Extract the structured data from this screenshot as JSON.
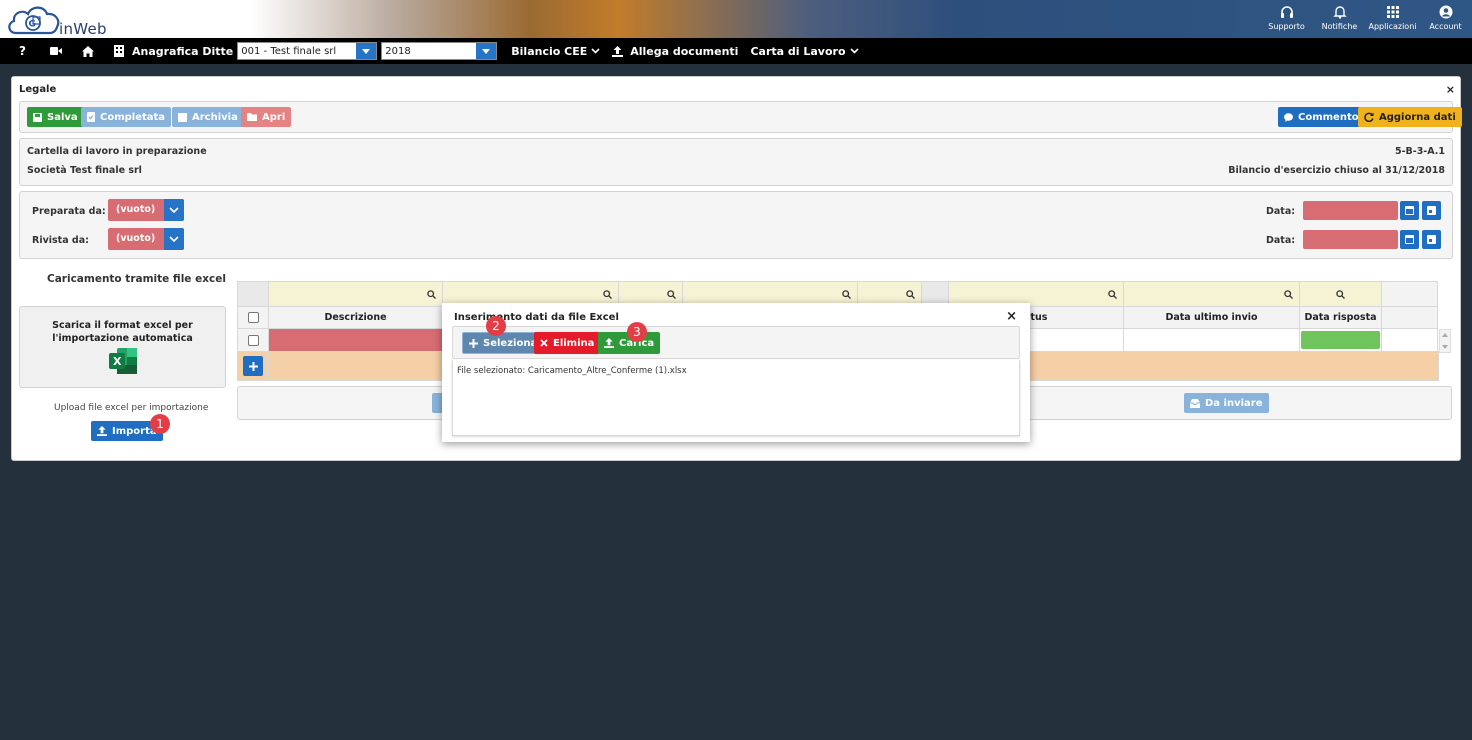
{
  "brand": {
    "logo_text": "inWeb"
  },
  "top_actions": [
    {
      "label": "Supporto",
      "icon": "headset-icon"
    },
    {
      "label": "Notifiche",
      "icon": "bell-icon"
    },
    {
      "label": "Applicazioni",
      "icon": "grid-icon"
    },
    {
      "label": "Account",
      "icon": "user-circle-icon"
    }
  ],
  "navbar": {
    "help": "?",
    "anagrafica_label": "Anagrafica Ditte",
    "company_select": "001 - Test finale srl",
    "year_select": "2018",
    "bilancio_label": "Bilancio CEE",
    "allega_label": "Allega documenti",
    "carta_label": "Carta di Lavoro"
  },
  "panel": {
    "title": "Legale",
    "close": "×",
    "toolbar": {
      "salva": "Salva",
      "completata": "Completata",
      "archivia": "Archivia",
      "apri": "Apri",
      "commento": "Commento",
      "aggiorna": "Aggiorna dati"
    },
    "info": {
      "status": "Cartella di lavoro in preparazione",
      "code": "5-B-3-A.1",
      "company": "Società Test finale srl",
      "period": "Bilancio d'esercizio chiuso al 31/12/2018"
    },
    "review": {
      "preparata_label": "Preparata da:",
      "preparata_value": "(vuoto)",
      "rivista_label": "Rivista da:",
      "rivista_value": "(vuoto)",
      "data_label_1": "Data:",
      "data_label_2": "Data:"
    },
    "excel": {
      "heading": "Caricamento tramite file excel",
      "download_text": "Scarica il format excel per l'importazione automatica",
      "upload_text": "Upload file excel per importazione",
      "importa": "Importa"
    },
    "grid": {
      "col_descrizione": "Descrizione",
      "col_status": "atus",
      "col_data_ultimo_invio": "Data ultimo invio",
      "col_data_risposta": "Data risposta",
      "btn_da_inviare": "Da inviare"
    }
  },
  "modal": {
    "title": "Inserimento dati da file Excel",
    "close": "×",
    "seleziona": "Seleziona",
    "elimina": "Elimina",
    "carica": "Carica",
    "file_text": "File selezionato: Caricamento_Altre_Conferme (1).xlsx"
  },
  "badges": [
    "1",
    "2",
    "3"
  ],
  "colors": {
    "primary_blue": "#1f6ec1",
    "success_green": "#2f9a3a",
    "danger_red": "#e31b2b",
    "warning_yellow": "#f0b21c",
    "empty_field_red": "#d76d73",
    "badge_red": "#e33e46"
  }
}
